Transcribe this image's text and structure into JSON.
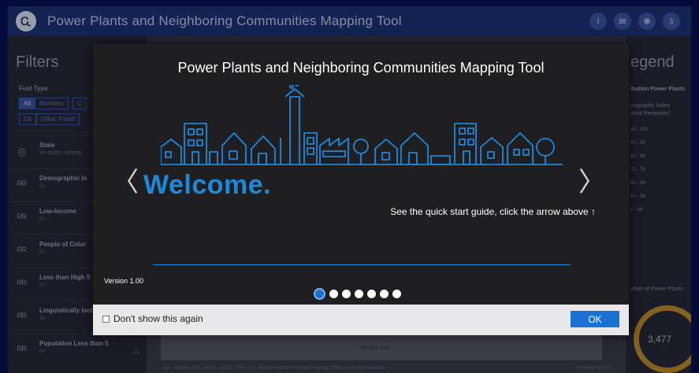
{
  "header": {
    "logo_glyph": "Ꮹ",
    "title": "Power Plants and Neighboring Communities Mapping Tool",
    "icons": [
      "info-icon",
      "mail-icon",
      "share-icon",
      "download-icon"
    ],
    "icon_glyphs": [
      "i",
      "✉",
      "❋",
      "⇩"
    ]
  },
  "filters": {
    "title": "Filters",
    "fuel_type_label": "Fuel Type",
    "chips": [
      "All",
      "Biomass",
      "C",
      "Oil",
      "Other Fossil"
    ],
    "rows": [
      {
        "label": "State",
        "sub": "No states selecte",
        "icon": "globe-icon",
        "glyph": "◎"
      },
      {
        "label": "Demographic In",
        "sub": "0+",
        "icon": "people-icon",
        "glyph": "ᴿᴿ"
      },
      {
        "label": "Low-Income",
        "sub": "0+",
        "icon": "people-icon",
        "glyph": "ᴿᴿ"
      },
      {
        "label": "People of Color",
        "sub": "0+",
        "icon": "people-icon",
        "glyph": "ᴿᴿ"
      },
      {
        "label": "Less than High S",
        "sub": "0+",
        "icon": "people-icon",
        "glyph": "ᴿᴿ"
      },
      {
        "label": "Linguistically Isol",
        "sub": "0+",
        "icon": "people-icon",
        "glyph": "ᴿᴿ"
      },
      {
        "label": "Population Less than 5",
        "sub": "0+",
        "icon": "people-icon",
        "glyph": "ᴿᴿ"
      }
    ]
  },
  "map": {
    "city": "Mexico City",
    "attribution": "Esri, Garmin, FAO, NOAA, USGS, EPA | U.S. Environmental Protection Agency, Office of Air and Radiation",
    "powered": "Powered by Esri"
  },
  "legend": {
    "title": "egend",
    "subtitle": "ibution Power Plants",
    "index_label_1": "nographic Index",
    "index_label_2": "ional Percentile)",
    "ranges": [
      "95 - 100",
      "90 - 94",
      "80 - 89",
      "70 - 79",
      "60 - 69",
      "50 - 59",
      "0 - 49"
    ],
    "count_label": "mber of Power Plants",
    "count": "3,477"
  },
  "modal": {
    "title": "Power Plants and Neighboring Communities Mapping Tool",
    "welcome": "Welcome.",
    "guide": "See the quick start guide, click the arrow above ↑",
    "version": "Version 1.00",
    "prev_glyph": "〈",
    "next_glyph": "〉",
    "page_count": 7,
    "active_page": 1,
    "dont_show_label": "Don't show this again",
    "ok_label": "OK",
    "accent_color": "#1e88d9"
  }
}
